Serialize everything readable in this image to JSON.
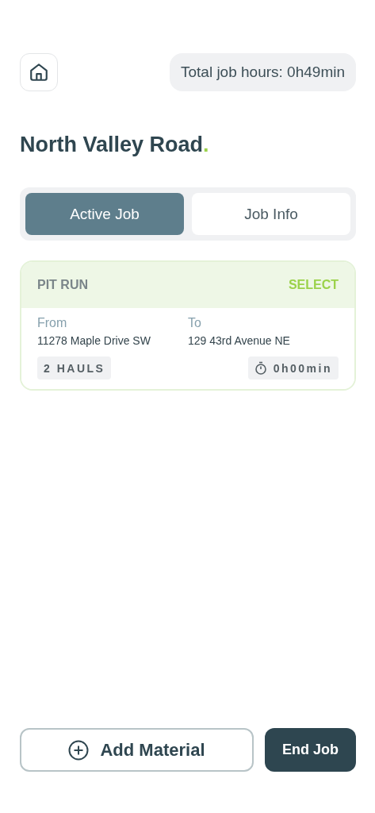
{
  "header": {
    "total_hours": "Total job hours: 0h49min"
  },
  "title": {
    "text": "North Valley Road",
    "mark": "."
  },
  "tabs": [
    {
      "label": "Active Job",
      "selected": true
    },
    {
      "label": "Job Info",
      "selected": false
    }
  ],
  "materials": [
    {
      "name": "PIT RUN",
      "action": "SELECT",
      "from_label": "From",
      "from": "11278 Maple Drive SW",
      "to_label": "To",
      "to": "129 43rd Avenue NE",
      "hauls": "2 HAULS",
      "time": "0h00min"
    }
  ],
  "buttons": {
    "add": "Add Material",
    "end": "End Job"
  }
}
